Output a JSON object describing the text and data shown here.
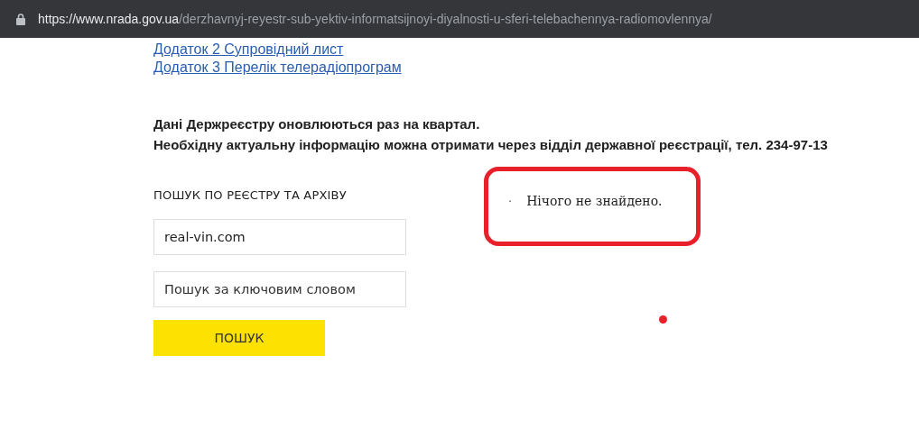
{
  "address_bar": {
    "host": "https://www.nrada.gov.ua",
    "path": "/derzhavnyj-reyestr-sub-yektiv-informatsijnoyi-diyalnosti-u-sferi-telebachennya-radiomovlennya/"
  },
  "links": [
    "Додаток 2 Супровідний лист",
    "Додаток 3 Перелік телерадіопрограм"
  ],
  "notice": [
    "Дані Держреєстру оновлюються раз на квартал.",
    "Необхідну актуальну інформацію можна отримати через відділ державної реєстрації, тел. 234-97-13"
  ],
  "search": {
    "heading": "ПОШУК ПО РЕЄСТРУ ТА АРХІВУ",
    "fields": [
      {
        "value": "real-vin.com"
      },
      {
        "placeholder": "Пошук за ключовим словом"
      }
    ],
    "button": "ПОШУК"
  },
  "results": {
    "bullet": "·",
    "message": "Нічого не знайдено."
  }
}
